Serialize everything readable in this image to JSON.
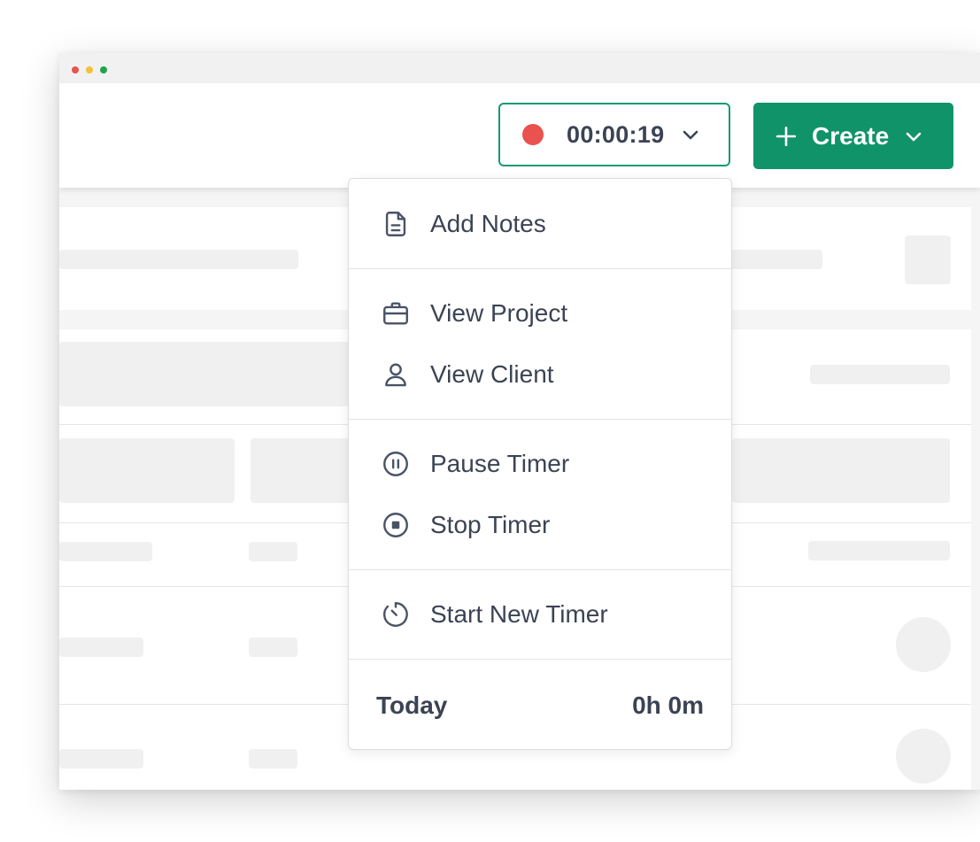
{
  "window": {
    "controls": [
      {
        "name": "close",
        "color": "#e9524e"
      },
      {
        "name": "minimize",
        "color": "#f2c336"
      },
      {
        "name": "maximize",
        "color": "#22a34a"
      }
    ]
  },
  "header": {
    "timer": {
      "value": "00:00:19",
      "recording_color": "#e9524e",
      "border_color": "#1a9a6c",
      "icon": "chevron-down-icon"
    },
    "create_button": {
      "label": "Create",
      "icon_left": "plus-icon",
      "icon_right": "chevron-down-icon",
      "color": "#11936a"
    }
  },
  "timer_menu": {
    "items": [
      {
        "label": "Add Notes",
        "icon": "document-icon"
      },
      {
        "label": "View Project",
        "icon": "briefcase-icon"
      },
      {
        "label": "View Client",
        "icon": "user-icon"
      },
      {
        "label": "Pause Timer",
        "icon": "pause-circle-icon"
      },
      {
        "label": "Stop Timer",
        "icon": "stop-circle-icon"
      },
      {
        "label": "Start New Timer",
        "icon": "stopwatch-icon"
      }
    ],
    "footer": {
      "label": "Today",
      "value": "0h 0m"
    }
  }
}
